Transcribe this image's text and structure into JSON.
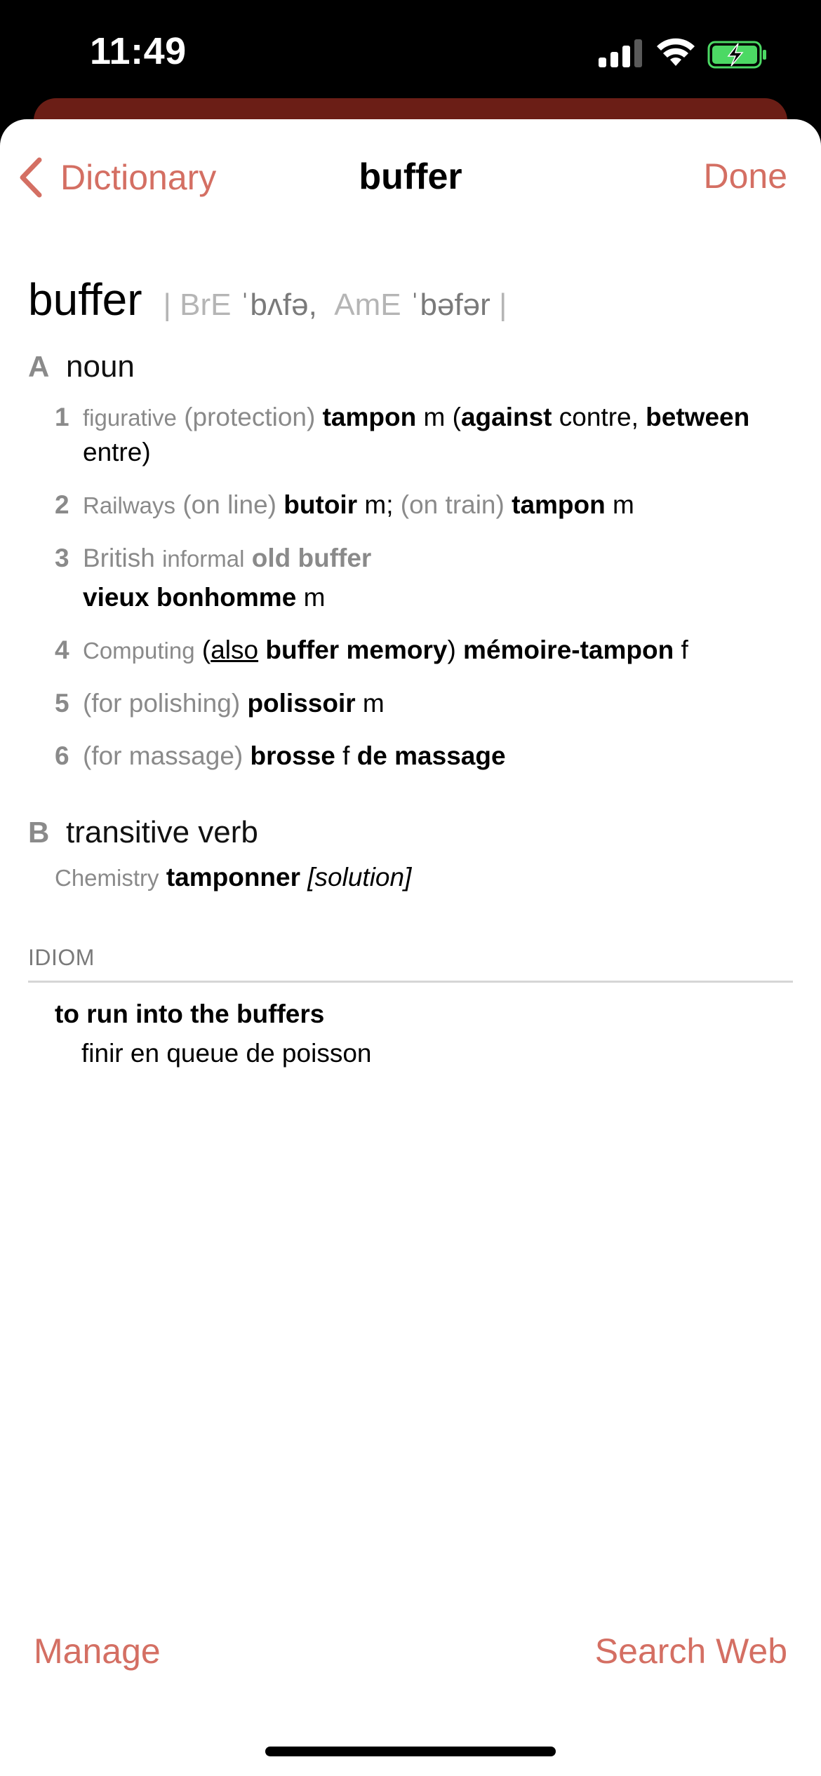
{
  "status_bar": {
    "time": "11:49"
  },
  "nav": {
    "back_label": "Dictionary",
    "title": "buffer",
    "done_label": "Done"
  },
  "entry": {
    "headword": "buffer",
    "pron": {
      "sep_open": "|",
      "bre_label": "BrE",
      "bre_ipa": "ˈbʌfə,",
      "ame_label": "AmE",
      "ame_ipa": "ˈbəfər",
      "sep_close": "|"
    },
    "noun": {
      "letter": "A",
      "label": "noun",
      "senses": [
        {
          "num": "1",
          "label": "figurative",
          "ctx": "(protection)",
          "tr": "tampon",
          "g": "m",
          "p_open": "(",
          "kw1": "against",
          "t1": "contre,",
          "kw2": "between",
          "t2": "entre)"
        },
        {
          "num": "2",
          "label": "Railways",
          "ctx1": "(on line)",
          "tr1": "butoir",
          "g1": "m;",
          "ctx2": "(on train)",
          "tr2": "tampon",
          "g2": "m"
        },
        {
          "num": "3",
          "label1": "British",
          "label2": "informal",
          "phrase": "old buffer",
          "tr": "vieux bonhomme",
          "g": "m"
        },
        {
          "num": "4",
          "label": "Computing",
          "p_open": "(",
          "also": "also",
          "phrase": "buffer memory",
          "p_close": ")",
          "tr": "mémoire-tampon",
          "g": "f"
        },
        {
          "num": "5",
          "ctx": "(for polishing)",
          "tr": "polissoir",
          "g": "m"
        },
        {
          "num": "6",
          "ctx": "(for massage)",
          "tr1": "brosse",
          "g": "f",
          "tr2": "de massage"
        }
      ]
    },
    "verb": {
      "letter": "B",
      "label": "transitive verb",
      "domain_label": "Chemistry",
      "tr": "tamponner",
      "obj": "[solution]"
    },
    "idiom": {
      "heading": "IDIOM",
      "phrase": "to run into the buffers",
      "translation": "finir en queue de poisson"
    }
  },
  "footer": {
    "manage_label": "Manage",
    "search_web_label": "Search Web"
  },
  "colors": {
    "accent": "#d46f63",
    "behind_sheet": "#6b1e16",
    "battery": "#4cd964"
  },
  "icons": [
    "chevron-left-icon",
    "cellular-signal-icon",
    "wifi-icon",
    "battery-charging-icon"
  ]
}
